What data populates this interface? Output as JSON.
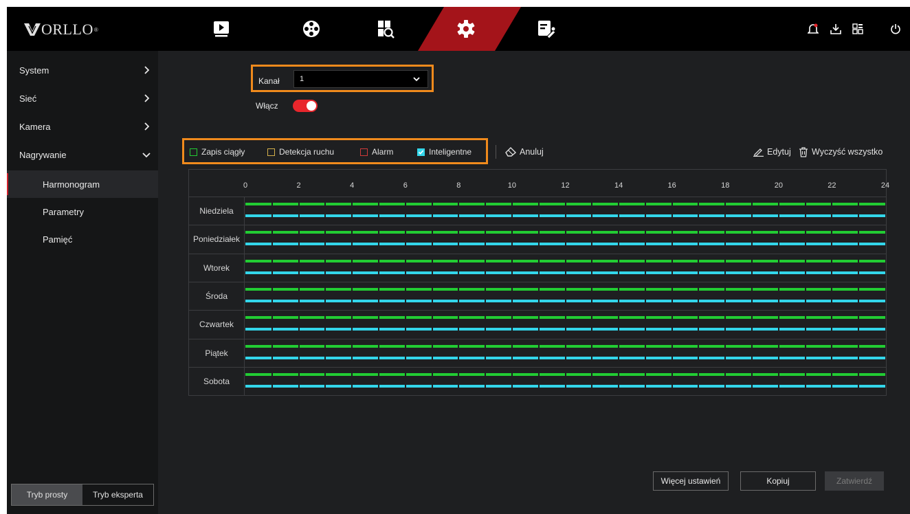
{
  "brand": {
    "logo_text": "ORLLO",
    "logo_mark": "®"
  },
  "nav": {
    "icons": [
      "playback-icon",
      "camera-reel-icon",
      "search-icon",
      "gear-icon",
      "maintenance-icon"
    ],
    "active": "gear-icon",
    "right_icons": [
      "notification-icon",
      "download-icon",
      "layout-icon",
      "power-icon"
    ]
  },
  "sidebar": {
    "items": [
      {
        "label": "System"
      },
      {
        "label": "Sieć"
      },
      {
        "label": "Kamera"
      },
      {
        "label": "Nagrywanie"
      }
    ],
    "subitems": [
      {
        "label": "Harmonogram",
        "active": true
      },
      {
        "label": "Parametry"
      },
      {
        "label": "Pamięć"
      }
    ],
    "mode": {
      "simple": "Tryb prosty",
      "expert": "Tryb eksperta",
      "selected": "simple"
    }
  },
  "channel": {
    "label": "Kanał",
    "value": "1"
  },
  "enable": {
    "label": "Włącz",
    "on": true
  },
  "legend": {
    "continuous": {
      "label": "Zapis ciągły",
      "color": "#22cc33",
      "checked": false
    },
    "motion": {
      "label": "Detekcja ruchu",
      "color": "#d4b04a",
      "checked": false
    },
    "alarm": {
      "label": "Alarm",
      "color": "#d03a3a",
      "checked": false
    },
    "intelligent": {
      "label": "Inteligentne",
      "color": "#33d6ea",
      "checked": true
    }
  },
  "actions": {
    "cancel": "Anuluj",
    "edit": "Edytuj",
    "clear_all": "Wyczyść wszystko"
  },
  "schedule": {
    "hours": [
      "0",
      "2",
      "4",
      "6",
      "8",
      "10",
      "12",
      "14",
      "16",
      "18",
      "20",
      "22",
      "24"
    ],
    "days": [
      "Niedziela",
      "Poniedziałek",
      "Wtorek",
      "Środa",
      "Czwartek",
      "Piątek",
      "Sobota"
    ],
    "continuous_range": [
      0,
      24
    ],
    "intelligent_range": [
      0,
      24
    ]
  },
  "buttons": {
    "more": "Więcej ustawień",
    "copy": "Kopiuj",
    "apply": "Zatwierdź"
  }
}
